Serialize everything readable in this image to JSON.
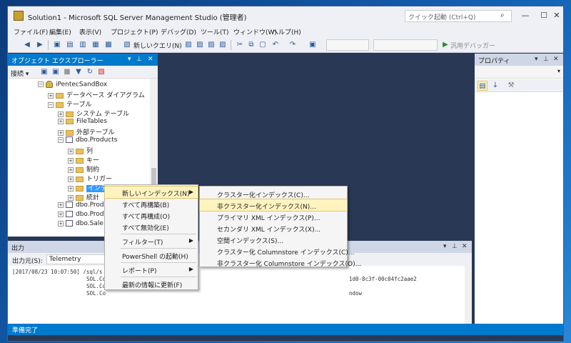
{
  "window": {
    "title": "Solution1 - Microsoft SQL Server Management Studio (管理者)",
    "quick_launch_placeholder": "クイック起動 (Ctrl+Q)"
  },
  "menubar": [
    "ファイル(F)",
    "編集(E)",
    "表示(V)",
    "プロジェクト(P)",
    "デバッグ(D)",
    "ツール(T)",
    "ウィンドウ(W)",
    "ヘルプ(H)"
  ],
  "toolbar": {
    "new_query": "新しいクエリ(N)",
    "debugger": "汎用デバッガー"
  },
  "object_explorer": {
    "title": "オブジェクト エクスプローラー",
    "connect": "接続 ▾",
    "tree": [
      {
        "label": "iPentecSandBox",
        "indent": 0
      },
      {
        "label": "データベース ダイアグラム",
        "indent": 1
      },
      {
        "label": "テーブル",
        "indent": 1
      },
      {
        "label": "システム テーブル",
        "indent": 2
      },
      {
        "label": "FileTables",
        "indent": 2
      },
      {
        "label": "外部テーブル",
        "indent": 2
      },
      {
        "label": "dbo.Products",
        "indent": 2
      },
      {
        "label": "列",
        "indent": 3
      },
      {
        "label": "キー",
        "indent": 3
      },
      {
        "label": "制約",
        "indent": 3
      },
      {
        "label": "トリガー",
        "indent": 3
      },
      {
        "label": "インデックス",
        "indent": 3
      },
      {
        "label": "統計",
        "indent": 3
      },
      {
        "label": "dbo.Produ",
        "indent": 2
      },
      {
        "label": "dbo.Produ",
        "indent": 2
      },
      {
        "label": "dbo.Sale",
        "indent": 2
      }
    ]
  },
  "context_menu": [
    {
      "label": "新しいインデックス(N)",
      "submenu": true
    },
    {
      "label": "すべて再構築(B)"
    },
    {
      "label": "すべて再構成(O)"
    },
    {
      "label": "すべて無効化(E)"
    },
    {
      "label": "フィルター(T)",
      "submenu": true
    },
    {
      "label": "PowerShell の起動(H)"
    },
    {
      "label": "レポート(P)",
      "submenu": true
    },
    {
      "label": "最新の情報に更新(F)"
    }
  ],
  "submenu": [
    "クラスター化インデックス(C)...",
    "非クラスター化インデックス(N)...",
    "プライマリ XML インデックス(P)...",
    "セカンダリ XML インデックス(X)...",
    "空間インデックス(S)...",
    "クラスター化 Columnstore インデックス(C)...",
    "非クラスター化 Columnstore インデックス(O)..."
  ],
  "properties": {
    "title": "プロパティ"
  },
  "output": {
    "title": "出力",
    "source_label": "出力元(S):",
    "source_value": "Telemetry",
    "lines": [
      "[2017/08/23 10:07:50] /sql/s",
      "SOL.Co",
      "SOL.Co",
      "SOL.Co"
    ],
    "guid_fragment": "1d0-8c3f-00c04fc2aae2",
    "window_fragment": "ndow"
  },
  "status": {
    "text": "準備完了"
  }
}
